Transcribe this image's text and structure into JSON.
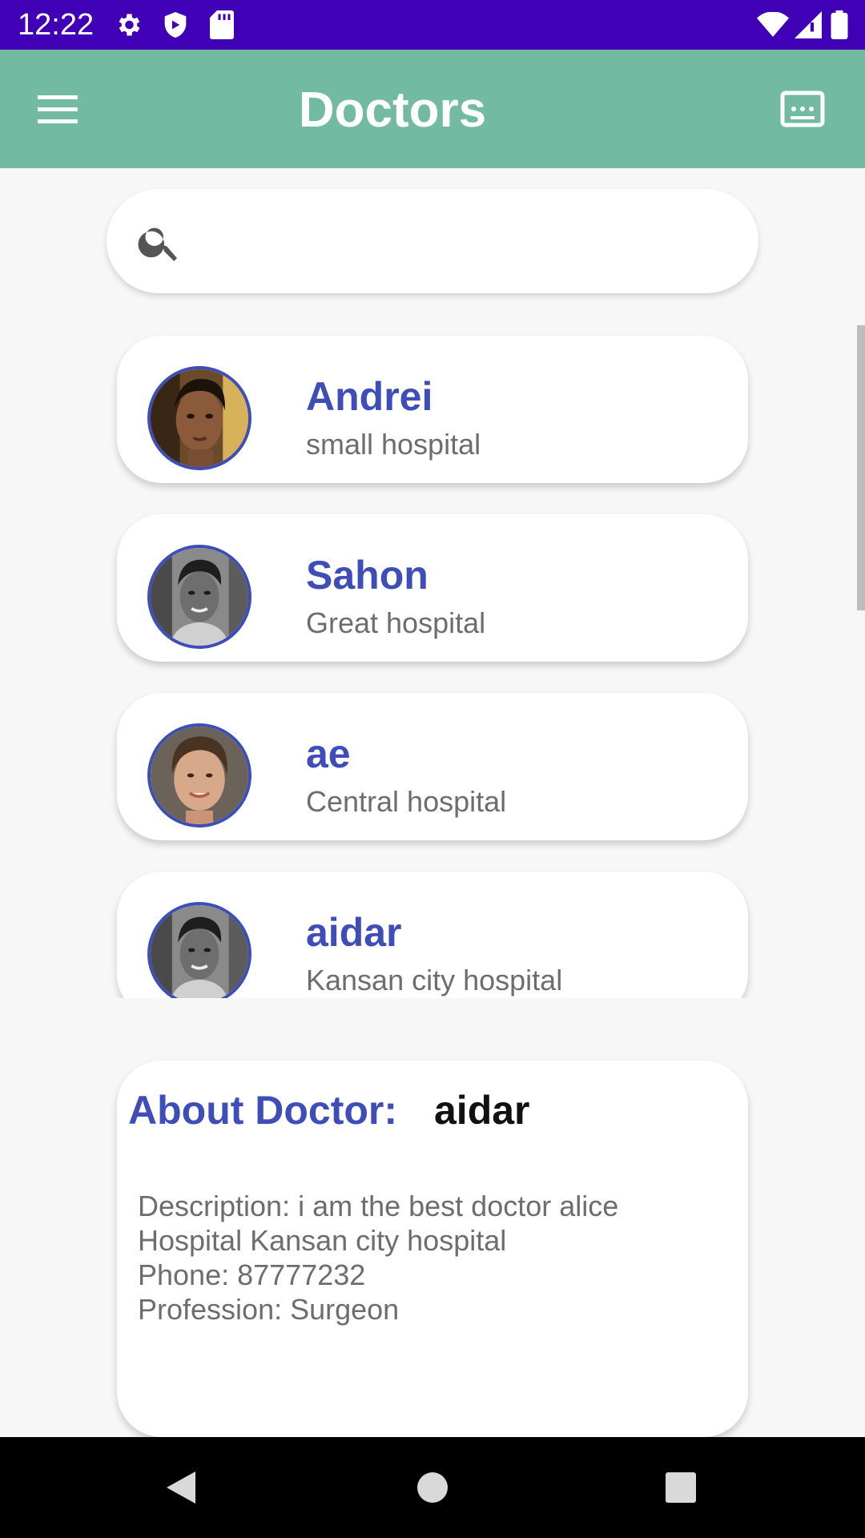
{
  "status_bar": {
    "time": "12:22",
    "left_icons": [
      "gear-icon",
      "shield-icon",
      "sd-card-icon"
    ],
    "right_icons": [
      "wifi-icon",
      "cell-signal-icon",
      "battery-icon"
    ],
    "background": "#3f00b6"
  },
  "app_bar": {
    "title": "Doctors",
    "menu_icon": "hamburger-menu-icon",
    "action_icon": "message-icon",
    "background": "#72baa1"
  },
  "search": {
    "placeholder": "",
    "value": "",
    "icon": "search-icon"
  },
  "doctors": [
    {
      "name": "Andrei",
      "hospital": "small hospital"
    },
    {
      "name": "Sahon",
      "hospital": "Great hospital"
    },
    {
      "name": "ae",
      "hospital": "Central hospital"
    },
    {
      "name": "aidar",
      "hospital": "Kansan city hospital"
    }
  ],
  "about": {
    "label": "About Doctor:",
    "name": "aidar",
    "description": "Description: i am the best doctor alice",
    "hospital": "Hospital Kansan city hospital",
    "phone": "Phone: 87777232",
    "profession": "Profession: Surgeon"
  },
  "nav_bar": {
    "icons": [
      "back-icon",
      "home-icon",
      "recents-icon"
    ]
  },
  "colors": {
    "accent": "#3f4db8",
    "secondary_text": "#6d6d6d"
  }
}
